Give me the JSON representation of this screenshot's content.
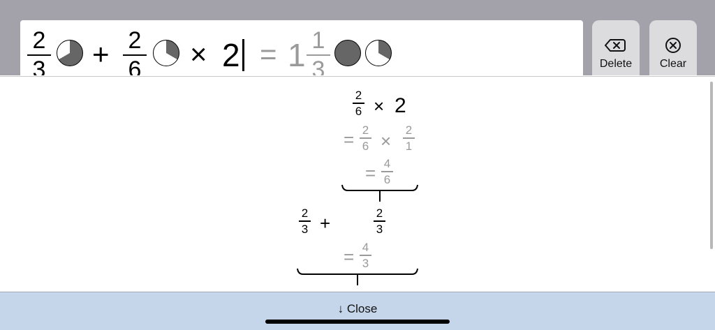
{
  "expression": {
    "term1": {
      "numerator": "2",
      "denominator": "3",
      "fill_fraction": 0.6667
    },
    "op1": "+",
    "term2": {
      "numerator": "2",
      "denominator": "6",
      "fill_fraction": 0.3333
    },
    "op2": "×",
    "multiplier": "2",
    "equals": "=",
    "result": {
      "whole": "1",
      "numerator": "1",
      "denominator": "3",
      "whole_pie_fill": 1.0,
      "frac_pie_fill": 0.3333
    }
  },
  "keys": {
    "delete_label": "Delete",
    "clear_label": "Clear"
  },
  "work": {
    "step1": {
      "numerator": "2",
      "denominator": "6",
      "op": "×",
      "operand": "2"
    },
    "step2": {
      "eq": "=",
      "a_num": "2",
      "a_den": "6",
      "op": "×",
      "b_num": "2",
      "b_den": "1"
    },
    "step3": {
      "eq": "=",
      "num": "4",
      "den": "6"
    },
    "step4": {
      "a_num": "2",
      "a_den": "3",
      "op": "+",
      "b_num": "2",
      "b_den": "3"
    },
    "step5": {
      "eq": "=",
      "num": "4",
      "den": "3"
    }
  },
  "close_label": "↓ Close",
  "colors": {
    "topbar": "#a3a1aa",
    "key_bg": "#dcdcdf",
    "pie_fill": "#666666",
    "hint_gray": "#9a9a9a",
    "close_bar": "#c5d5ea"
  }
}
